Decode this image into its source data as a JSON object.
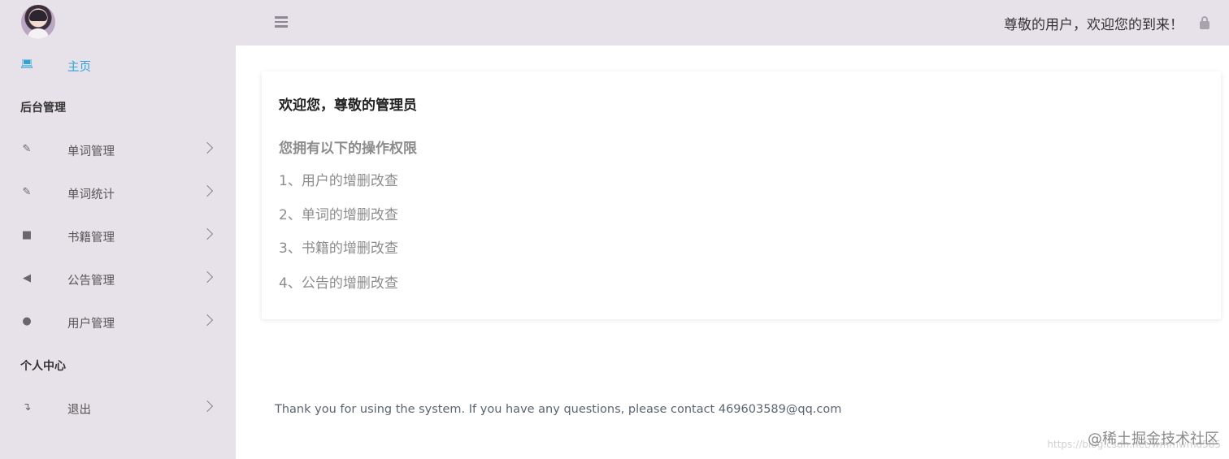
{
  "sidebar": {
    "home": {
      "label": "主页",
      "icon": "laptop-icon"
    },
    "section_admin": "后台管理",
    "items": [
      {
        "label": "单词管理",
        "icon": "edit-icon"
      },
      {
        "label": "单词统计",
        "icon": "edit-icon"
      },
      {
        "label": "书籍管理",
        "icon": "book-icon"
      },
      {
        "label": "公告管理",
        "icon": "volume-icon"
      },
      {
        "label": "用户管理",
        "icon": "user-icon"
      }
    ],
    "section_personal": "个人中心",
    "logout": {
      "label": "退出",
      "icon": "logout-icon"
    }
  },
  "header": {
    "greeting": "尊敬的用户，欢迎您的到来！",
    "menu_icon": "hamburger-icon",
    "lock_icon": "lock-icon"
  },
  "main": {
    "title": "欢迎您，尊敬的管理员",
    "permissions_heading": "您拥有以下的操作权限",
    "permissions": [
      "1、用户的增删改查",
      "2、单词的增删改查",
      "3、书籍的增删改查",
      "4、公告的增删改查"
    ]
  },
  "footer": {
    "text": "Thank you for using the system. If you have any questions, please contact 469603589@qq.com"
  },
  "watermark": {
    "text": "@稀土掘金技术社区",
    "url": "https://blog.csdn.net/wmmwmd585"
  },
  "colors": {
    "sidebar_bg": "#e7e1e9",
    "accent": "#2ea3d6",
    "muted_text": "#8c8c8c"
  }
}
